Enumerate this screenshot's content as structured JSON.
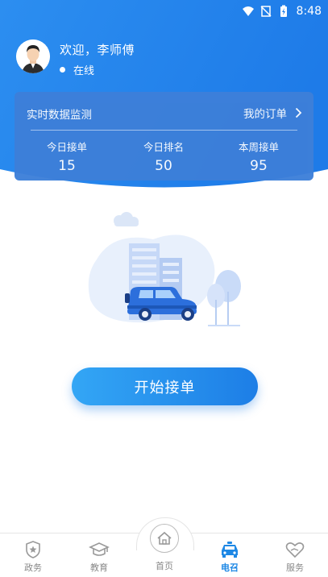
{
  "status_bar": {
    "time": "8:48"
  },
  "colors": {
    "primary": "#1e88e5",
    "panel": "#3d7fd9",
    "header_gradient_start": "#2c8ef0",
    "tab_inactive": "#888888"
  },
  "user": {
    "greeting": "欢迎，李师傅",
    "status": "在线",
    "avatar_icon": "driver-avatar"
  },
  "monitor": {
    "title": "实时数据监测",
    "orders_link": "我的订单",
    "stats": [
      {
        "label": "今日接单",
        "value": "15"
      },
      {
        "label": "今日排名",
        "value": "50"
      },
      {
        "label": "本周接单",
        "value": "95"
      }
    ]
  },
  "illustration": {
    "icon": "car-city-illustration"
  },
  "actions": {
    "start_label": "开始接单"
  },
  "tabs": {
    "gov": {
      "label": "政务",
      "icon": "shield-star-icon"
    },
    "edu": {
      "label": "教育",
      "icon": "graduation-cap-icon"
    },
    "home": {
      "label": "首页",
      "icon": "home-icon"
    },
    "call": {
      "label": "电召",
      "icon": "taxi-icon"
    },
    "service": {
      "label": "服务",
      "icon": "heart-hand-icon"
    }
  }
}
